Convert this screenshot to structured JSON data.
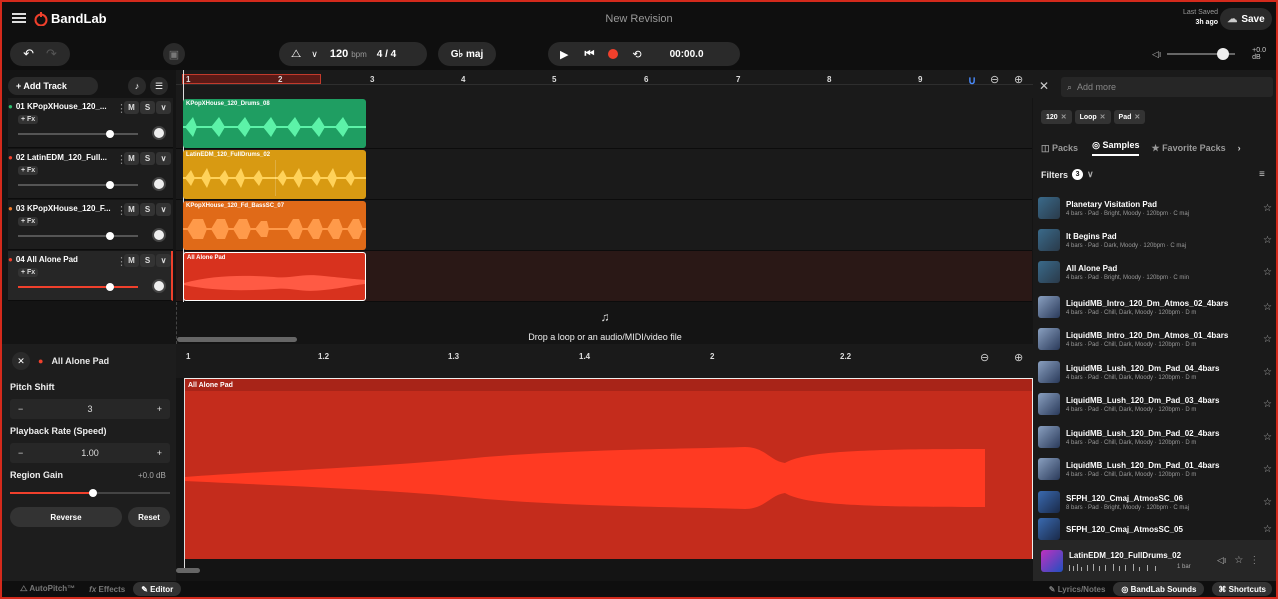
{
  "app": {
    "brand": "BandLab",
    "revision_title": "New Revision",
    "last_saved_label": "Last Saved",
    "last_saved_time": "3h ago",
    "save_label": "Save"
  },
  "toolbar": {
    "bpm_value": "120",
    "bpm_unit": "bpm",
    "time_signature": "4 / 4",
    "key": "G♭ maj",
    "time_display": "00:00.0",
    "master_volume": "+0.0 dB"
  },
  "tracks": {
    "add_track_label": "+ Add Track",
    "items": [
      {
        "name": "01  KPopXHouse_120_...",
        "fx": "+ Fx",
        "m": "M",
        "s": "S",
        "region": "KPopXHouse_120_Drums_08",
        "color": "#1f9e62"
      },
      {
        "name": "02  LatinEDM_120_Full...",
        "fx": "+ Fx",
        "m": "M",
        "s": "S",
        "region": "LatinEDM_120_FullDrums_02",
        "color": "#d89a12"
      },
      {
        "name": "03  KPopXHouse_120_F...",
        "fx": "+ Fx",
        "m": "M",
        "s": "S",
        "region": "KPopXHouse_120_Fd_BassSC_07",
        "color": "#e06a18"
      },
      {
        "name": "04  All Alone Pad",
        "fx": "+ Fx",
        "m": "M",
        "s": "S",
        "region": "All Alone Pad",
        "color": "#d8321e"
      }
    ],
    "drop_hint": "Drop a loop or an audio/MIDI/video file"
  },
  "ruler": [
    "1",
    "2",
    "3",
    "4",
    "5",
    "6",
    "7",
    "8",
    "9"
  ],
  "editor": {
    "track_name": "All Alone Pad",
    "region_label": "All Alone Pad",
    "ruler": [
      "1",
      "1.2",
      "1.3",
      "1.4",
      "2",
      "2.2"
    ],
    "pitch_shift_label": "Pitch Shift",
    "pitch_shift_value": "3",
    "playback_rate_label": "Playback Rate (Speed)",
    "playback_rate_value": "1.00",
    "region_gain_label": "Region Gain",
    "region_gain_value": "+0.0 dB",
    "reverse_label": "Reverse",
    "reset_label": "Reset"
  },
  "sidepanel": {
    "search_placeholder": "Add more",
    "tags": [
      "120",
      "Loop",
      "Pad"
    ],
    "tab_packs": "Packs",
    "tab_samples": "Samples",
    "tab_favorites": "Favorite Packs",
    "filters_label": "Filters",
    "filters_count": "3",
    "samples": [
      {
        "name": "Planetary Visitation Pad",
        "meta": "4 bars · Pad · Bright, Moody · 120bpm · C maj"
      },
      {
        "name": "It Begins Pad",
        "meta": "4 bars · Pad · Dark, Moody · 120bpm · C maj"
      },
      {
        "name": "All Alone Pad",
        "meta": "4 bars · Pad · Bright, Moody · 120bpm · C min"
      },
      {
        "name": "LiquidMB_Intro_120_Dm_Atmos_02_4bars",
        "meta": "4 bars · Pad · Chill, Dark, Moody · 120bpm · D m"
      },
      {
        "name": "LiquidMB_Intro_120_Dm_Atmos_01_4bars",
        "meta": "4 bars · Pad · Chill, Dark, Moody · 120bpm · D m"
      },
      {
        "name": "LiquidMB_Lush_120_Dm_Pad_04_4bars",
        "meta": "4 bars · Pad · Chill, Dark, Moody · 120bpm · D m"
      },
      {
        "name": "LiquidMB_Lush_120_Dm_Pad_03_4bars",
        "meta": "4 bars · Pad · Chill, Dark, Moody · 120bpm · D m"
      },
      {
        "name": "LiquidMB_Lush_120_Dm_Pad_02_4bars",
        "meta": "4 bars · Pad · Chill, Dark, Moody · 120bpm · D m"
      },
      {
        "name": "LiquidMB_Lush_120_Dm_Pad_01_4bars",
        "meta": "4 bars · Pad · Chill, Dark, Moody · 120bpm · D m"
      },
      {
        "name": "SFPH_120_Cmaj_AtmosSC_06",
        "meta": "8 bars · Pad · Bright, Moody · 120bpm · C maj"
      },
      {
        "name": "SFPH_120_Cmaj_AtmosSC_05",
        "meta": ""
      }
    ],
    "now_playing": {
      "name": "LatinEDM_120_FullDrums_02",
      "length": "1 bar"
    }
  },
  "bottom": {
    "autopitch": "AutoPitch™",
    "effects": "Effects",
    "editor": "Editor",
    "lyrics": "Lyrics/Notes",
    "sounds": "BandLab Sounds",
    "shortcuts": "Shortcuts"
  }
}
